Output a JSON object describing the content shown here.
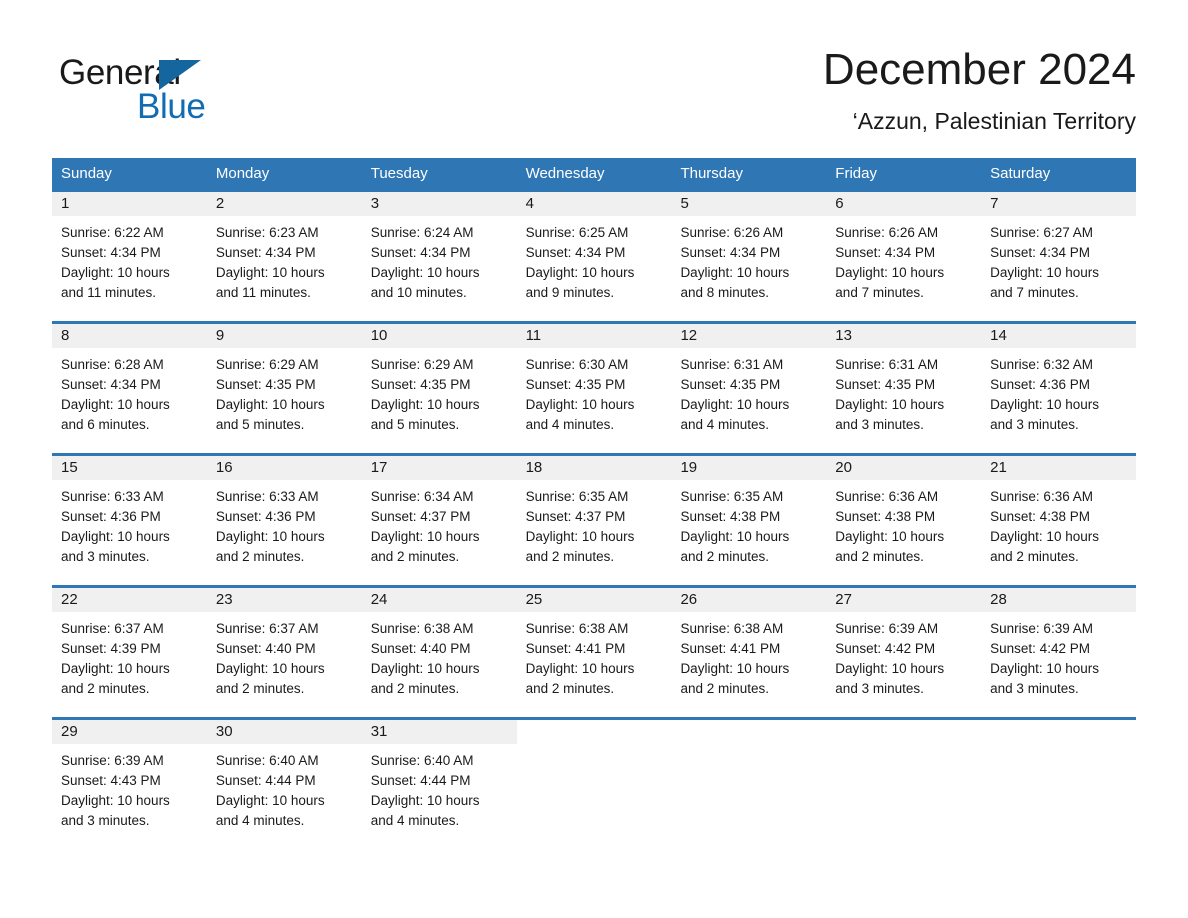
{
  "brand": {
    "name_part1": "General",
    "name_part2": "Blue",
    "flag_icon": "triangle-flag-icon",
    "accent_color": "#136cb2"
  },
  "header": {
    "month_title": "December 2024",
    "location": "‘Azzun, Palestinian Territory"
  },
  "calendar": {
    "header_bg_color": "#2f76b5",
    "daynum_bg_color": "#f0f0f0",
    "weekdays": [
      "Sunday",
      "Monday",
      "Tuesday",
      "Wednesday",
      "Thursday",
      "Friday",
      "Saturday"
    ],
    "weeks": [
      [
        {
          "day": "1",
          "sunrise": "Sunrise: 6:22 AM",
          "sunset": "Sunset: 4:34 PM",
          "daylight_line1": "Daylight: 10 hours",
          "daylight_line2": "and 11 minutes."
        },
        {
          "day": "2",
          "sunrise": "Sunrise: 6:23 AM",
          "sunset": "Sunset: 4:34 PM",
          "daylight_line1": "Daylight: 10 hours",
          "daylight_line2": "and 11 minutes."
        },
        {
          "day": "3",
          "sunrise": "Sunrise: 6:24 AM",
          "sunset": "Sunset: 4:34 PM",
          "daylight_line1": "Daylight: 10 hours",
          "daylight_line2": "and 10 minutes."
        },
        {
          "day": "4",
          "sunrise": "Sunrise: 6:25 AM",
          "sunset": "Sunset: 4:34 PM",
          "daylight_line1": "Daylight: 10 hours",
          "daylight_line2": "and 9 minutes."
        },
        {
          "day": "5",
          "sunrise": "Sunrise: 6:26 AM",
          "sunset": "Sunset: 4:34 PM",
          "daylight_line1": "Daylight: 10 hours",
          "daylight_line2": "and 8 minutes."
        },
        {
          "day": "6",
          "sunrise": "Sunrise: 6:26 AM",
          "sunset": "Sunset: 4:34 PM",
          "daylight_line1": "Daylight: 10 hours",
          "daylight_line2": "and 7 minutes."
        },
        {
          "day": "7",
          "sunrise": "Sunrise: 6:27 AM",
          "sunset": "Sunset: 4:34 PM",
          "daylight_line1": "Daylight: 10 hours",
          "daylight_line2": "and 7 minutes."
        }
      ],
      [
        {
          "day": "8",
          "sunrise": "Sunrise: 6:28 AM",
          "sunset": "Sunset: 4:34 PM",
          "daylight_line1": "Daylight: 10 hours",
          "daylight_line2": "and 6 minutes."
        },
        {
          "day": "9",
          "sunrise": "Sunrise: 6:29 AM",
          "sunset": "Sunset: 4:35 PM",
          "daylight_line1": "Daylight: 10 hours",
          "daylight_line2": "and 5 minutes."
        },
        {
          "day": "10",
          "sunrise": "Sunrise: 6:29 AM",
          "sunset": "Sunset: 4:35 PM",
          "daylight_line1": "Daylight: 10 hours",
          "daylight_line2": "and 5 minutes."
        },
        {
          "day": "11",
          "sunrise": "Sunrise: 6:30 AM",
          "sunset": "Sunset: 4:35 PM",
          "daylight_line1": "Daylight: 10 hours",
          "daylight_line2": "and 4 minutes."
        },
        {
          "day": "12",
          "sunrise": "Sunrise: 6:31 AM",
          "sunset": "Sunset: 4:35 PM",
          "daylight_line1": "Daylight: 10 hours",
          "daylight_line2": "and 4 minutes."
        },
        {
          "day": "13",
          "sunrise": "Sunrise: 6:31 AM",
          "sunset": "Sunset: 4:35 PM",
          "daylight_line1": "Daylight: 10 hours",
          "daylight_line2": "and 3 minutes."
        },
        {
          "day": "14",
          "sunrise": "Sunrise: 6:32 AM",
          "sunset": "Sunset: 4:36 PM",
          "daylight_line1": "Daylight: 10 hours",
          "daylight_line2": "and 3 minutes."
        }
      ],
      [
        {
          "day": "15",
          "sunrise": "Sunrise: 6:33 AM",
          "sunset": "Sunset: 4:36 PM",
          "daylight_line1": "Daylight: 10 hours",
          "daylight_line2": "and 3 minutes."
        },
        {
          "day": "16",
          "sunrise": "Sunrise: 6:33 AM",
          "sunset": "Sunset: 4:36 PM",
          "daylight_line1": "Daylight: 10 hours",
          "daylight_line2": "and 2 minutes."
        },
        {
          "day": "17",
          "sunrise": "Sunrise: 6:34 AM",
          "sunset": "Sunset: 4:37 PM",
          "daylight_line1": "Daylight: 10 hours",
          "daylight_line2": "and 2 minutes."
        },
        {
          "day": "18",
          "sunrise": "Sunrise: 6:35 AM",
          "sunset": "Sunset: 4:37 PM",
          "daylight_line1": "Daylight: 10 hours",
          "daylight_line2": "and 2 minutes."
        },
        {
          "day": "19",
          "sunrise": "Sunrise: 6:35 AM",
          "sunset": "Sunset: 4:38 PM",
          "daylight_line1": "Daylight: 10 hours",
          "daylight_line2": "and 2 minutes."
        },
        {
          "day": "20",
          "sunrise": "Sunrise: 6:36 AM",
          "sunset": "Sunset: 4:38 PM",
          "daylight_line1": "Daylight: 10 hours",
          "daylight_line2": "and 2 minutes."
        },
        {
          "day": "21",
          "sunrise": "Sunrise: 6:36 AM",
          "sunset": "Sunset: 4:38 PM",
          "daylight_line1": "Daylight: 10 hours",
          "daylight_line2": "and 2 minutes."
        }
      ],
      [
        {
          "day": "22",
          "sunrise": "Sunrise: 6:37 AM",
          "sunset": "Sunset: 4:39 PM",
          "daylight_line1": "Daylight: 10 hours",
          "daylight_line2": "and 2 minutes."
        },
        {
          "day": "23",
          "sunrise": "Sunrise: 6:37 AM",
          "sunset": "Sunset: 4:40 PM",
          "daylight_line1": "Daylight: 10 hours",
          "daylight_line2": "and 2 minutes."
        },
        {
          "day": "24",
          "sunrise": "Sunrise: 6:38 AM",
          "sunset": "Sunset: 4:40 PM",
          "daylight_line1": "Daylight: 10 hours",
          "daylight_line2": "and 2 minutes."
        },
        {
          "day": "25",
          "sunrise": "Sunrise: 6:38 AM",
          "sunset": "Sunset: 4:41 PM",
          "daylight_line1": "Daylight: 10 hours",
          "daylight_line2": "and 2 minutes."
        },
        {
          "day": "26",
          "sunrise": "Sunrise: 6:38 AM",
          "sunset": "Sunset: 4:41 PM",
          "daylight_line1": "Daylight: 10 hours",
          "daylight_line2": "and 2 minutes."
        },
        {
          "day": "27",
          "sunrise": "Sunrise: 6:39 AM",
          "sunset": "Sunset: 4:42 PM",
          "daylight_line1": "Daylight: 10 hours",
          "daylight_line2": "and 3 minutes."
        },
        {
          "day": "28",
          "sunrise": "Sunrise: 6:39 AM",
          "sunset": "Sunset: 4:42 PM",
          "daylight_line1": "Daylight: 10 hours",
          "daylight_line2": "and 3 minutes."
        }
      ],
      [
        {
          "day": "29",
          "sunrise": "Sunrise: 6:39 AM",
          "sunset": "Sunset: 4:43 PM",
          "daylight_line1": "Daylight: 10 hours",
          "daylight_line2": "and 3 minutes."
        },
        {
          "day": "30",
          "sunrise": "Sunrise: 6:40 AM",
          "sunset": "Sunset: 4:44 PM",
          "daylight_line1": "Daylight: 10 hours",
          "daylight_line2": "and 4 minutes."
        },
        {
          "day": "31",
          "sunrise": "Sunrise: 6:40 AM",
          "sunset": "Sunset: 4:44 PM",
          "daylight_line1": "Daylight: 10 hours",
          "daylight_line2": "and 4 minutes."
        },
        {
          "day": "",
          "sunrise": "",
          "sunset": "",
          "daylight_line1": "",
          "daylight_line2": ""
        },
        {
          "day": "",
          "sunrise": "",
          "sunset": "",
          "daylight_line1": "",
          "daylight_line2": ""
        },
        {
          "day": "",
          "sunrise": "",
          "sunset": "",
          "daylight_line1": "",
          "daylight_line2": ""
        },
        {
          "day": "",
          "sunrise": "",
          "sunset": "",
          "daylight_line1": "",
          "daylight_line2": ""
        }
      ]
    ]
  }
}
